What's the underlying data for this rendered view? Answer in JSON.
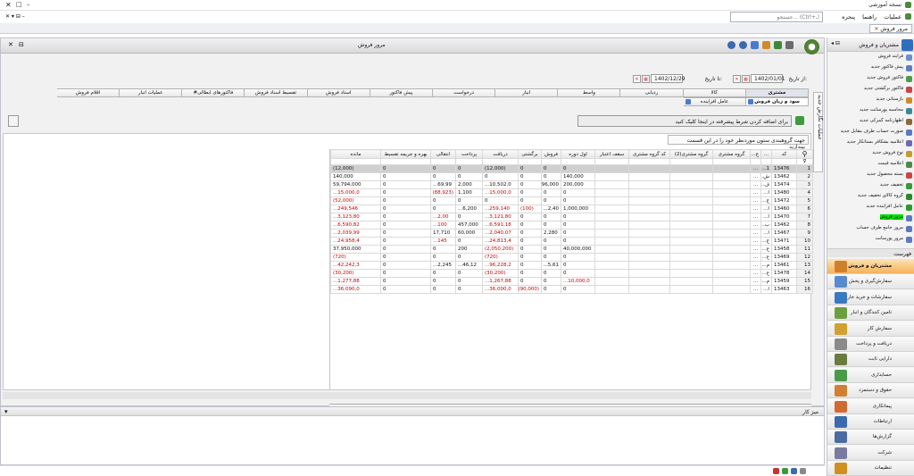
{
  "app": {
    "title": "نسخه آموزشی",
    "search_placeholder": "جستجو... (Ctrl+ـ)"
  },
  "menu": [
    "عملیات",
    "راهنما",
    "پنجره"
  ],
  "open_tab": "مرور فروش",
  "main": {
    "title": "مرور فروش",
    "vertical_tab": "عملیات نگارش جدید",
    "from_label": "از تاریخ:",
    "from_date": "1402/01/01",
    "to_label": "تا تاریخ:",
    "to_date": "1402/12/29",
    "tabs_row1": [
      "مشتری",
      "کالا",
      "ردیابی",
      "واسط",
      "انبار",
      "درخواست",
      "پیش فاکتور",
      "اسناد فروش",
      "تقسیط اسناد فروش",
      "#فاکتورهای ابطالی",
      "عملیات انبار",
      "اقلام فروش"
    ],
    "tabs_row2": [
      "سود و زیان فروش",
      "عامل افزاینده"
    ],
    "condition_text": "برای اضافه کردن شرط پیشرفته در اینجا کلیک کنید",
    "group_text": "جهت گروهبندی ستون موردنظر خود را در این قسمت بیندازید"
  },
  "grid": {
    "columns": [
      "",
      "کد",
      "...",
      "ع...",
      "گروه مشتری",
      "گروه مشتری(2)",
      "کد گروه مشتری",
      "سقف اعتبار",
      "اول دوره",
      "فروش",
      "برگشتی",
      "دریافت",
      "پرداخت",
      "انتقالی",
      "بهره و جریمه تقسیط",
      "مانده"
    ],
    "rows": [
      [
        "1",
        "13476",
        "1...",
        "...",
        "",
        "",
        "",
        "",
        "0",
        "0",
        "0",
        "(12,000)",
        "0",
        "0",
        "0",
        "(12,000)"
      ],
      [
        "2",
        "13462",
        "ش...",
        "...",
        "",
        "",
        "",
        "",
        "140,000",
        "0",
        "0",
        "0",
        "0",
        "0",
        "0",
        "140,000"
      ],
      [
        "3",
        "13474",
        "ف...",
        "...",
        "",
        "",
        "",
        "",
        "200,000",
        "96,000",
        "0",
        "10,502,0...",
        "2,000",
        "69,99...",
        "0",
        "59,794,000"
      ],
      [
        "4",
        "13480",
        "ا...",
        "...",
        "",
        "",
        "",
        "",
        "0",
        "0",
        "0",
        "15,000,0...",
        "1,100",
        "(88,923)",
        "0",
        "15,000,0..."
      ],
      [
        "5",
        "13472",
        "ج...",
        "...",
        "",
        "",
        "",
        "",
        "0",
        "0",
        "0",
        "0",
        "0",
        "0",
        "0",
        "(52,000)"
      ],
      [
        "6",
        "13460",
        "ا...",
        "...",
        "",
        "",
        "",
        "",
        "1,000,000",
        "2,40...",
        "(100)",
        "259,140...",
        "6,200...",
        "0",
        "0",
        "249,546..."
      ],
      [
        "7",
        "13470",
        "ا...",
        "...",
        "",
        "",
        "",
        "",
        "0",
        "0",
        "0",
        "3,121,80...",
        "0",
        "2,00...",
        "0",
        "3,123,80..."
      ],
      [
        "8",
        "13462",
        "ب...",
        "...",
        "",
        "",
        "",
        "",
        "0",
        "0",
        "0",
        "6,591,18...",
        "457,000",
        "100...",
        "0",
        "6,590,82..."
      ],
      [
        "9",
        "13467",
        "ا...",
        "...",
        "",
        "",
        "",
        "",
        "0",
        "2,280",
        "0",
        "2,040,07...",
        "60,000",
        "17,710",
        "0",
        "2,039,99..."
      ],
      [
        "10",
        "13471",
        "ج...",
        "...",
        "",
        "",
        "",
        "",
        "0",
        "0",
        "0",
        "24,813,4...",
        "0",
        "145...",
        "0",
        "24,958,4..."
      ],
      [
        "11",
        "13458",
        "ع...",
        "...",
        "",
        "",
        "",
        "",
        "40,000,000",
        "0",
        "0",
        "(2,050,200)",
        "200",
        "0",
        "0",
        "37,950,000"
      ],
      [
        "12",
        "13469",
        "ع...",
        "...",
        "",
        "",
        "",
        "",
        "0",
        "0",
        "0",
        "(720)",
        "0",
        "0",
        "0",
        "(720)"
      ],
      [
        "13",
        "13461",
        "م...",
        "...",
        "",
        "",
        "",
        "",
        "0",
        "5,61...",
        "0",
        "96,228,2...",
        "46,12...",
        "2,245...",
        "0",
        "42,242,3..."
      ],
      [
        "14",
        "13478",
        "ع...",
        "...",
        "",
        "",
        "",
        "",
        "0",
        "0",
        "0",
        "(30,200)",
        "0",
        "0",
        "0",
        "(30,200)"
      ],
      [
        "15",
        "13459",
        "م...",
        "...",
        "",
        "",
        "",
        "",
        "10,000,0...",
        "0",
        "0",
        "1,267,88...",
        "0",
        "0",
        "0",
        "1,277,88..."
      ],
      [
        "16",
        "13463",
        "ا...",
        "...",
        "",
        "",
        "",
        "",
        "0",
        "0",
        "(90,000)",
        "36,000,0...",
        "0",
        "0",
        "0",
        "36,090,0..."
      ]
    ],
    "negatives": [
      [],
      [],
      [],
      [
        11,
        13,
        15
      ],
      [
        15
      ],
      [
        10,
        11,
        15
      ],
      [
        11,
        13,
        15
      ],
      [
        11,
        13,
        15
      ],
      [
        11,
        15
      ],
      [
        11,
        13,
        15
      ],
      [
        11
      ],
      [
        11,
        15
      ],
      [
        11,
        15
      ],
      [
        11,
        15
      ],
      [
        8,
        11,
        15
      ],
      [
        10,
        11,
        15
      ]
    ],
    "footer": [
      "0",
      "31,340,000",
      "8,11...",
      "(90,100)",
      "28,449,8...",
      "52,84...",
      "69,92...",
      "0",
      "28,287,6..."
    ]
  },
  "work": {
    "title": "میز کار"
  },
  "nav": {
    "title": "مشتریان و فروش",
    "items": [
      {
        "label": "فرآیند فروش",
        "color": "#6a8fd0"
      },
      {
        "label": "پیش فاکتور جدید",
        "color": "#5b7fc4"
      },
      {
        "label": "فاکتور فروش جدید",
        "color": "#4a9c4a"
      },
      {
        "label": "فاکتور برگشتی جدید",
        "color": "#c44"
      },
      {
        "label": "بازستانی جدید",
        "color": "#d08a2a"
      },
      {
        "label": "محاسبه پورسانت جدید",
        "color": "#3a8a9a"
      },
      {
        "label": "اظهارنامه گمرکی جدید",
        "color": "#8a6a3a"
      },
      {
        "label": "صورت حساب طرف مقابل جدید",
        "color": "#5a7ac0"
      },
      {
        "label": "اعلامیه بشکافر بستانکار جدید",
        "color": "#6a6ab0"
      },
      {
        "label": "نوع فروش جدید",
        "color": "#c99a2a"
      },
      {
        "label": "اعلامیه قیمت",
        "color": "#4a8a4a"
      },
      {
        "label": "بسته محصول جدید",
        "color": "#c44"
      },
      {
        "label": "تخفیف جدید",
        "color": "#3a9a3a"
      },
      {
        "label": "گروه کالای تخفیف جدید",
        "color": "#2a8a2a"
      },
      {
        "label": "عامل افزاینده جدید",
        "color": "#2a9a2a"
      },
      {
        "label": "مرور فروش",
        "color": "#5a7ac0",
        "highlight": true
      },
      {
        "label": "مرور جامع طرف حساب",
        "color": "#5a7ac0"
      },
      {
        "label": "مرور پورسانت",
        "color": "#5a7ac0"
      }
    ],
    "list_label": "فهرست",
    "categories": [
      {
        "label": "مشتریان و فروش",
        "color": "#d0802a",
        "selected": true
      },
      {
        "label": "سفارش‌گیری و پخش",
        "color": "#5a8ad0"
      },
      {
        "label": "سفارشات و خرید خارجی",
        "color": "#3a7ac0"
      },
      {
        "label": "تامین کنندگان و انبار",
        "color": "#6aa040"
      },
      {
        "label": "سفارش کار",
        "color": "#d0a030"
      },
      {
        "label": "دریافت و پرداخت",
        "color": "#8a8a8a"
      },
      {
        "label": "دارایی ثابت",
        "color": "#6a7a40"
      },
      {
        "label": "حسابداری",
        "color": "#4a9a4a"
      },
      {
        "label": "حقوق و دستمزد",
        "color": "#d08030"
      },
      {
        "label": "پیمانکاری",
        "color": "#d06a30"
      },
      {
        "label": "ارتباطات",
        "color": "#3a6ab0"
      },
      {
        "label": "گزارش‌ها",
        "color": "#4a6aa0"
      },
      {
        "label": "شرکت",
        "color": "#7a7aa0"
      },
      {
        "label": "تنظیمات",
        "color": "#d09020"
      }
    ]
  }
}
